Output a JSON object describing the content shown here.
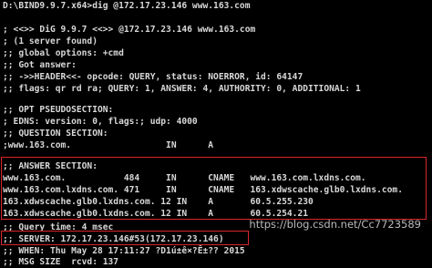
{
  "lines": [
    "D:\\BIND9.9.7.x64>dig @172.17.23.146 www.163.com",
    "",
    "; <<>> DiG 9.9.7 <<>> @172.17.23.146 www.163.com",
    "; (1 server found)",
    ";; global options: +cmd",
    ";; Got answer:",
    ";; ->>HEADER<<- opcode: QUERY, status: NOERROR, id: 64147",
    ";; flags: qr rd ra; QUERY: 1, ANSWER: 4, AUTHORITY: 0, ADDITIONAL: 1",
    "",
    ";; OPT PSEUDOSECTION:",
    "; EDNS: version: 0, flags:; udp: 4000",
    ";; QUESTION SECTION:",
    ";www.163.com.                  IN      A",
    "",
    ";; ANSWER SECTION:",
    "www.163.com.           484     IN      CNAME   www.163.com.lxdns.com.",
    "www.163.com.lxdns.com. 471     IN      CNAME   163.xdwscache.glb0.lxdns.com.",
    "163.xdwscache.glb0.lxdns.com. 12 IN    A       60.5.255.230",
    "163.xdwscache.glb0.lxdns.com. 12 IN    A       60.5.254.21",
    "",
    ";; Query time: 4 msec",
    ";; SERVER: 172.17.23.146#53(172.17.23.146)",
    ";; WHEN: Thu May 28 17:11:27 ?D1ú±ê×?Ê±?? 2015",
    ";; MSG SIZE  rcvd: 137"
  ],
  "watermark": "https://blog.csdn.net/Cc7723589"
}
